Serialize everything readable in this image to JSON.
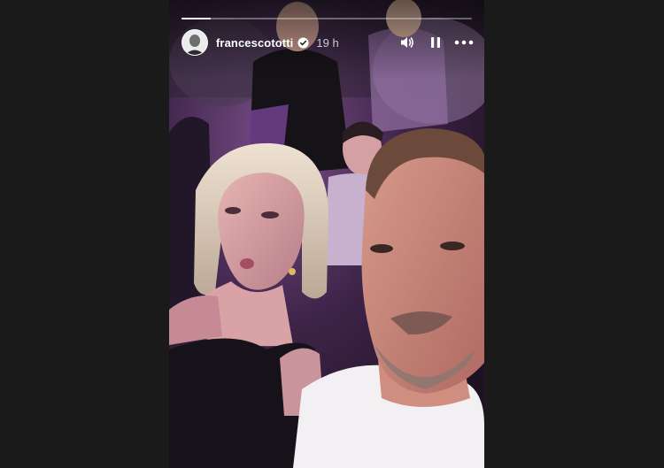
{
  "story": {
    "username": "francescototti",
    "time": "19 h",
    "progress": 0.1,
    "photo_alt": ""
  },
  "icons": {
    "verified": "verified-badge-icon",
    "sound": "speaker-icon",
    "pause": "pause-icon",
    "more": "more-options-icon"
  },
  "colors": {
    "page_background": "#1a1a1a",
    "verified_badge": "#ffffff",
    "text": "#ffffff"
  }
}
